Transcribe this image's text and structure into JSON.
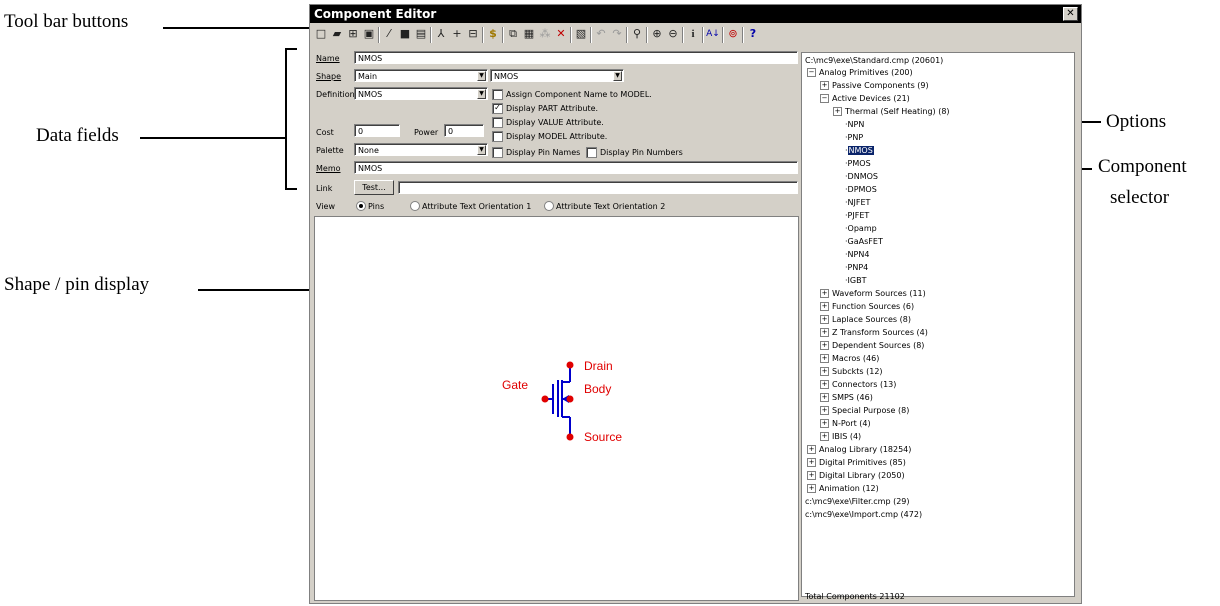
{
  "annotations": {
    "toolbar_buttons": "Tool bar buttons",
    "data_fields": "Data fields",
    "options": "Options",
    "component_selector_line1": "Component",
    "component_selector_line2": "selector",
    "shape_pin_display": "Shape / pin display"
  },
  "window": {
    "title": "Component Editor",
    "close": "✕"
  },
  "toolbar_icons": [
    "new-icon",
    "open-icon",
    "grid-icon",
    "save-icon",
    "wand-icon",
    "picture-icon",
    "page-icon",
    "merge-icon",
    "pin-add-icon",
    "pin-remove-icon",
    "dollar-icon",
    "copy-icon",
    "paste-icon",
    "paste-special-icon",
    "delete-icon",
    "replace-icon",
    "undo-icon",
    "redo-icon",
    "find-icon",
    "zoom-in-icon",
    "zoom-out-icon",
    "info-icon",
    "sort-icon",
    "stop-icon",
    "help-icon"
  ],
  "form": {
    "name_label": "Name",
    "name_value": "NMOS",
    "shape_label": "Shape",
    "shape_value": "Main",
    "shape2_value": "NMOS",
    "definition_label": "Definition",
    "definition_value": "NMOS",
    "cost_label": "Cost",
    "cost_value": "0",
    "power_label": "Power",
    "power_value": "0",
    "palette_label": "Palette",
    "palette_value": "None",
    "memo_label": "Memo",
    "memo_value": "NMOS",
    "link_label": "Link",
    "test_button": "Test...",
    "link_value": "",
    "view_label": "View"
  },
  "options": {
    "assign_name": "Assign Component Name to MODEL.",
    "display_part": "Display PART Attribute.",
    "display_value": "Display VALUE Attribute.",
    "display_model": "Display MODEL Attribute.",
    "display_pin_names": "Display Pin Names",
    "display_pin_numbers": "Display Pin Numbers",
    "display_part_checked": "✓"
  },
  "view_options": {
    "pins": "Pins",
    "orient1": "Attribute Text Orientation 1",
    "orient2": "Attribute Text Orientation 2"
  },
  "shape_labels": {
    "drain": "Drain",
    "body": "Body",
    "gate": "Gate",
    "source": "Source"
  },
  "tree": {
    "root": "C:\\mc9\\exe\\Standard.cmp (20601)",
    "analog_primitives": "Analog Primitives (200)",
    "passive": "Passive Components (9)",
    "active": "Active Devices (21)",
    "thermal": "Thermal (Self Heating) (8)",
    "devices": [
      "NPN",
      "PNP",
      "NMOS",
      "PMOS",
      "DNMOS",
      "DPMOS",
      "NJFET",
      "PJFET",
      "Opamp",
      "GaAsFET",
      "NPN4",
      "PNP4",
      "IGBT"
    ],
    "groups": [
      "Waveform Sources (11)",
      "Function Sources (6)",
      "Laplace Sources (8)",
      "Z Transform Sources (4)",
      "Dependent Sources (8)",
      "Macros (46)",
      "Subckts (12)",
      "Connectors (13)",
      "SMPS (46)",
      "Special Purpose (8)",
      "N-Port (4)",
      "IBIS (4)"
    ],
    "top_groups": [
      "Analog Library (18254)",
      "Digital Primitives (85)",
      "Digital Library (2050)",
      "Animation (12)"
    ],
    "filter": "c:\\mc9\\exe\\Filter.cmp (29)",
    "import": "c:\\mc9\\exe\\Import.cmp (472)"
  },
  "status": "Total Components 21102",
  "colors": {
    "accent": "#0000cc",
    "pin": "#e00000",
    "selection": "#0a246a"
  }
}
